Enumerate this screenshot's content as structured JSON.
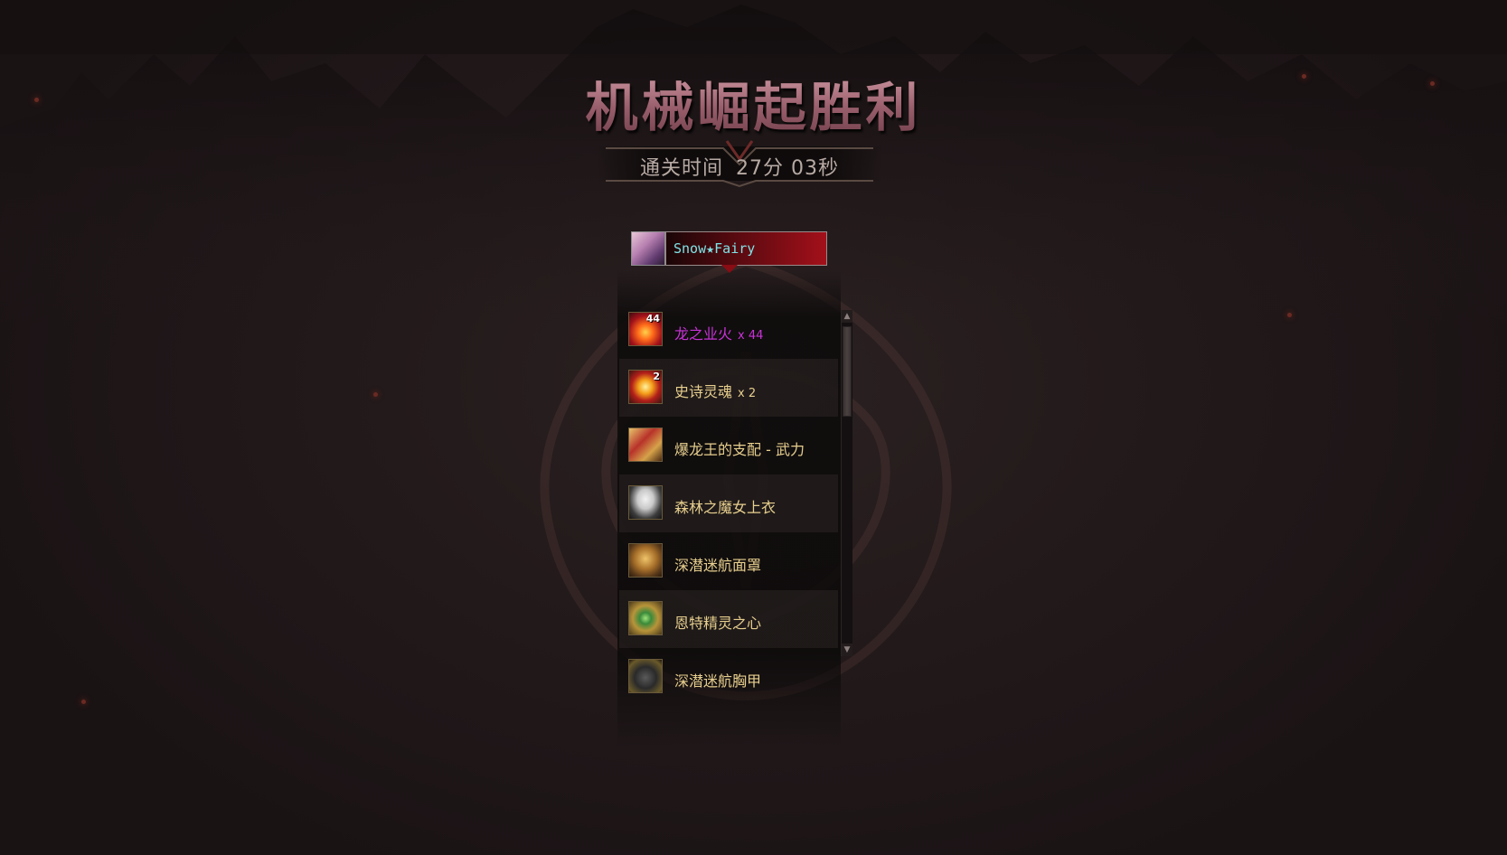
{
  "result": {
    "title": "机械崛起胜利",
    "clear_time_label": "通关时间",
    "clear_time_value": "27分 03秒"
  },
  "player": {
    "name": "Snow★Fairy",
    "name_color": "#7fe2e6"
  },
  "rewards": [
    {
      "name": "龙之业火",
      "quantity": "x 44",
      "badge": "44",
      "rarity": "epic",
      "icon": "dragon-fire-icon"
    },
    {
      "name": "史诗灵魂",
      "quantity": "x 2",
      "badge": "2",
      "rarity": "rare",
      "icon": "epic-soul-icon"
    },
    {
      "name": "爆龙王的支配 - 武力",
      "quantity": "",
      "badge": "",
      "rarity": "rare",
      "icon": "dragon-king-dominion-icon"
    },
    {
      "name": "森林之魔女上衣",
      "quantity": "",
      "badge": "",
      "rarity": "rare",
      "icon": "forest-witch-coat-icon"
    },
    {
      "name": "深潜迷航面罩",
      "quantity": "",
      "badge": "",
      "rarity": "rare",
      "icon": "deep-dive-mask-icon"
    },
    {
      "name": "恩特精灵之心",
      "quantity": "",
      "badge": "",
      "rarity": "rare",
      "icon": "ent-spirit-heart-icon"
    },
    {
      "name": "深潜迷航胸甲",
      "quantity": "",
      "badge": "",
      "rarity": "rare",
      "icon": "deep-dive-chestplate-icon"
    }
  ],
  "colors": {
    "epic": "#c832d8",
    "rare": "#e7cf8e",
    "title": "#a9707c"
  },
  "scroll": {
    "up_glyph": "▲",
    "down_glyph": "▼"
  }
}
